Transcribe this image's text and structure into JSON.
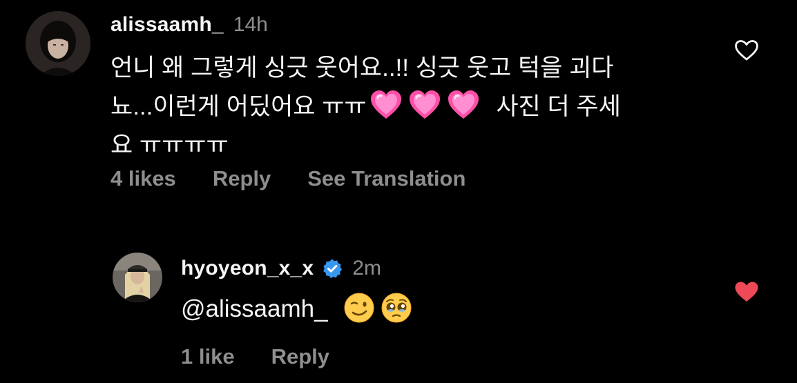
{
  "colors": {
    "background": "#000000",
    "primary_text": "#f5f5f5",
    "secondary_text": "#8e8e8e",
    "liked_heart": "#ed4956",
    "verified_badge": "#3897f0",
    "sparkling_heart": "#ff5fb4"
  },
  "comments": [
    {
      "username": "alissaamh_",
      "time": "14h",
      "avatar_icon": "user-avatar-photo",
      "text_lines": [
        "언니 왜 그렇게 싱긋 웃어요..!! 싱긋 웃고 턱을 괴다",
        "뇨...이런게 어딨어요 ㅠㅠ",
        "사진 더 주세",
        "요 ㅠㅠㅠㅠ"
      ],
      "inline_emoji": [
        "sparkling-heart-emoji",
        "sparkling-heart-emoji",
        "sparkling-heart-emoji"
      ],
      "likes_label": "4 likes",
      "reply_label": "Reply",
      "translate_label": "See Translation",
      "liked": false,
      "heart_icon": "heart-outline-icon"
    },
    {
      "username": "hyoyeon_x_x",
      "verified": true,
      "verified_icon": "verified-badge-icon",
      "time": "2m",
      "avatar_icon": "user-avatar-photo",
      "text": "@alissaamh_",
      "inline_emoji": [
        "winking-face-emoji",
        "pleading-face-emoji"
      ],
      "likes_label": "1 like",
      "reply_label": "Reply",
      "liked": true,
      "heart_icon": "heart-filled-icon"
    }
  ]
}
